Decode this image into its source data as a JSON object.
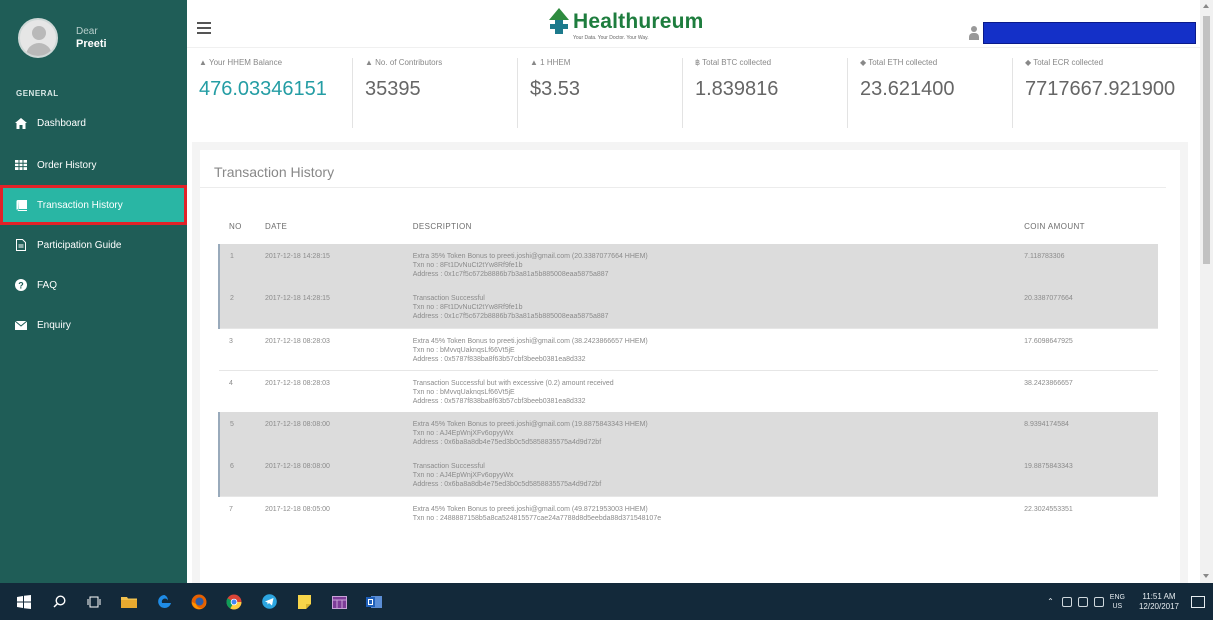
{
  "profile": {
    "welcome": "Dear",
    "name": "Preeti"
  },
  "sidebar": {
    "section": "GENERAL",
    "items": [
      {
        "label": "Dashboard",
        "icon": "home-icon"
      },
      {
        "label": "Order History",
        "icon": "table-icon"
      },
      {
        "label": "Transaction History",
        "icon": "book-icon",
        "active": true
      },
      {
        "label": "Participation Guide",
        "icon": "document-icon"
      },
      {
        "label": "FAQ",
        "icon": "question-icon"
      },
      {
        "label": "Enquiry",
        "icon": "envelope-icon"
      }
    ]
  },
  "header": {
    "logo": "Healthureum",
    "tagline": "Your Data. Your Doctor. Your Way."
  },
  "stats": [
    {
      "label": "Your HHEM Balance",
      "value": "476.03346151"
    },
    {
      "label": "No. of Contributors",
      "value": "35395"
    },
    {
      "label": "1 HHEM",
      "value": "$3.53"
    },
    {
      "label": "Total BTC collected",
      "value": "1.839816"
    },
    {
      "label": "Total ETH collected",
      "value": "23.621400"
    },
    {
      "label": "Total ECR collected",
      "value": "7717667.921900"
    }
  ],
  "panel": {
    "title": "Transaction History",
    "columns": [
      "NO",
      "DATE",
      "DESCRIPTION",
      "COIN AMOUNT"
    ],
    "rows": [
      {
        "no": "1",
        "date": "2017-12-18 14:28:15",
        "d1": "Extra 35% Token Bonus to preeti.joshi@gmail.com (20.3387077664 HHEM)",
        "d2": "Txn no : 8Ft1DvNuCt2tYw8Rf9fe1b",
        "d3": "Address : 0x1c7f5c672b8886b7b3a81a5b885008eaa5875a887",
        "amount": "7.118783306"
      },
      {
        "no": "2",
        "date": "2017-12-18 14:28:15",
        "d1": "Transaction Successful",
        "d2": "Txn no : 8Ft1DvNuCt2tYw8Rf9fe1b",
        "d3": "Address : 0x1c7f5c672b8886b7b3a81a5b885008eaa5875a887",
        "amount": "20.3387077664"
      },
      {
        "no": "3",
        "date": "2017-12-18 08:28:03",
        "d1": "Extra 45% Token Bonus to preeti.joshi@gmail.com (38.2423866657 HHEM)",
        "d2": "Txn no : bMvvqUaknqsLf66Vt5jE",
        "d3": "Address : 0x5787f838ba8f63b57cbf3beeb0381ea8d332",
        "amount": "17.6098647925"
      },
      {
        "no": "4",
        "date": "2017-12-18 08:28:03",
        "d1": "Transaction Successful but with excessive (0.2) amount received",
        "d2": "Txn no : bMvvqUaknqsLf66Vt5jE",
        "d3": "Address : 0x5787f838ba8f63b57cbf3beeb0381ea8d332",
        "amount": "38.2423866657"
      },
      {
        "no": "5",
        "date": "2017-12-18 08:08:00",
        "d1": "Extra 45% Token Bonus to preeti.joshi@gmail.com (19.8875843343 HHEM)",
        "d2": "Txn no : AJ4EpWnjXFv6opyyWx",
        "d3": "Address : 0x6ba8a8db4e75ed3b0c5d5858835575a4d9d72bf",
        "amount": "8.9394174584"
      },
      {
        "no": "6",
        "date": "2017-12-18 08:08:00",
        "d1": "Transaction Successful",
        "d2": "Txn no : AJ4EpWnjXFv6opyyWx",
        "d3": "Address : 0x6ba8a8db4e75ed3b0c5d5858835575a4d9d72bf",
        "amount": "19.8875843343"
      },
      {
        "no": "7",
        "date": "2017-12-18 08:05:00",
        "d1": "Extra 45% Token Bonus to preeti.joshi@gmail.com (49.8721953003 HHEM)",
        "d2": "Txn no : 2488887158b5a8ca524815577cae24a7788d8d5eebda88d371548107e",
        "d3": "",
        "amount": "22.3024553351"
      }
    ]
  },
  "taskbar": {
    "icons": [
      "windows-icon",
      "search-icon",
      "task-view-icon",
      "file-explorer-icon",
      "edge-icon",
      "firefox-icon",
      "chrome-icon",
      "telegram-icon",
      "sticky-notes-icon",
      "calendar-icon",
      "outlook-icon"
    ],
    "lang": "ENG",
    "region": "US",
    "time": "11:51 AM",
    "date": "12/20/2017"
  },
  "colors": {
    "sidebar": "#1f5d57",
    "active": "#29b6a4",
    "highlight": "#e12228",
    "balance": "#249da4",
    "taskbar": "#13293a"
  }
}
